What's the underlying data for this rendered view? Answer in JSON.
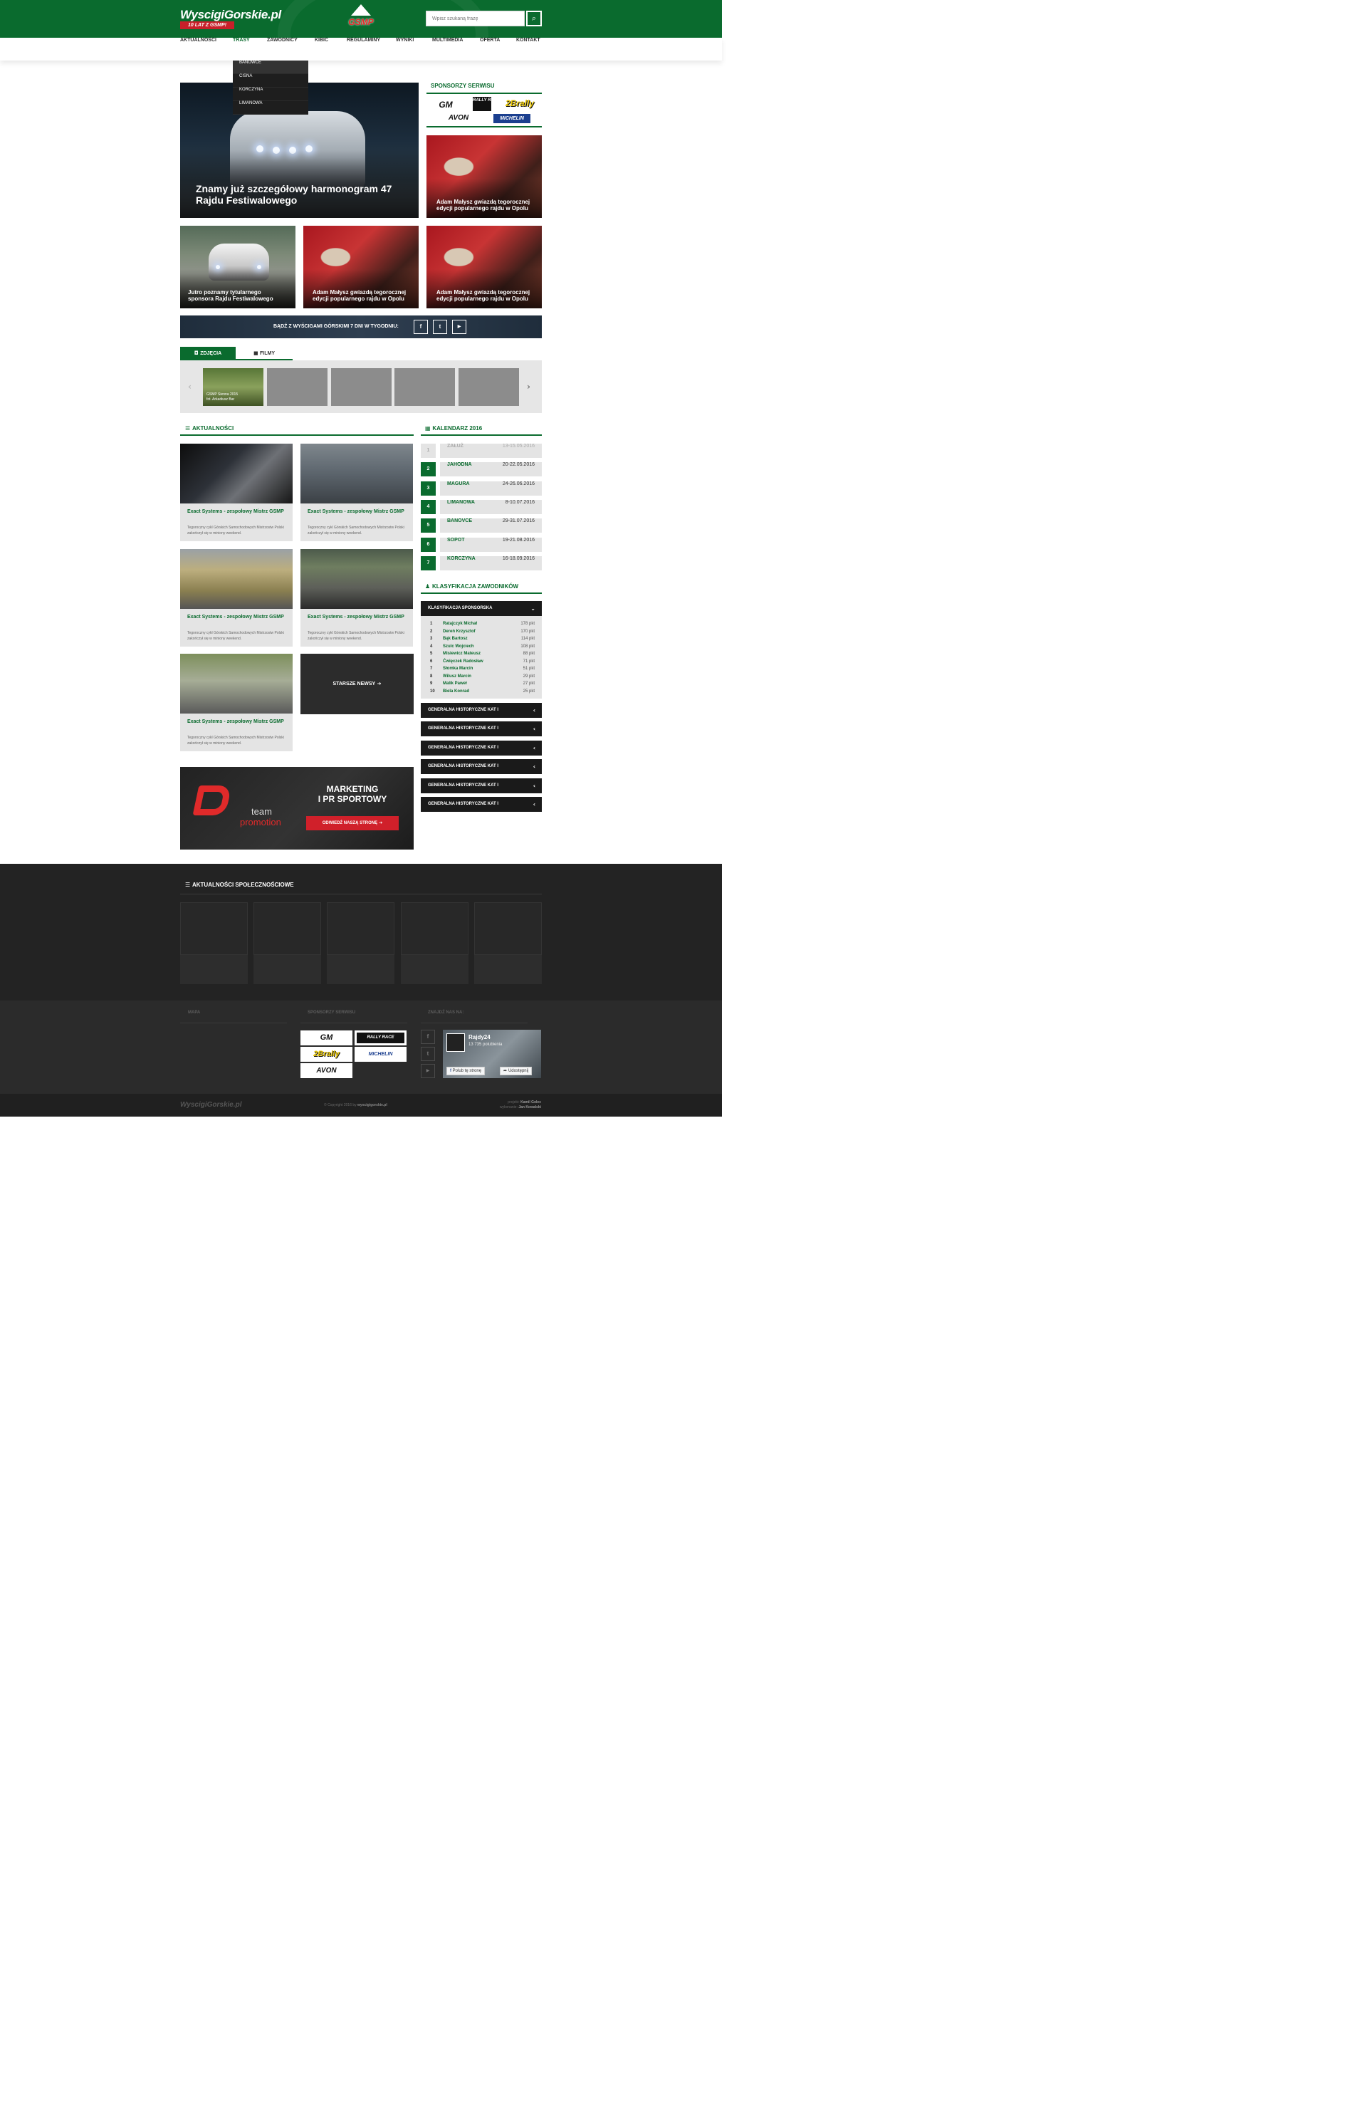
{
  "header": {
    "logo_text": "WyscigiGorskie.pl",
    "logo_badge": "10 LAT Z GSMP!",
    "center_logo": "GSMP",
    "search_placeholder": "Wpisz szukaną frazę",
    "search_icon": "search-icon"
  },
  "nav": {
    "items": [
      "AKTUALNOŚCI",
      "TRASY",
      "ZAWODNICY",
      "KIBIC",
      "REGULAMINY",
      "WYNIKI",
      "MULTIMEDIA",
      "OFERTA",
      "KONTAKT"
    ],
    "active": "TRASY",
    "dropdown": [
      "BANOWCE",
      "CISNA",
      "KORCZYNA",
      "LIMANOWA"
    ]
  },
  "hero": {
    "title": "Znamy już szczegółowy harmonogram 47 Rajdu Festiwalowego"
  },
  "sponsors": {
    "title": "SPONSORZY SERWISU",
    "logos": [
      "GM",
      "RALLY RACE",
      "2Brally",
      "AVON",
      "MICHELIN"
    ]
  },
  "featured": [
    {
      "title": "Adam Małysz gwiazdą tegorocznej edycji popularnego rajdu w Opolu"
    },
    {
      "title": "Jutro poznamy tytularnego sponsora Rajdu Festiwalowego"
    },
    {
      "title": "Adam Małysz gwiazdą tegorocznej edycji popularnego rajdu w Opolu"
    },
    {
      "title": "Adam Małysz gwiazdą tegorocznej edycji popularnego rajdu w Opolu"
    }
  ],
  "social_banner": {
    "text": "BĄDŹ Z WYŚCIGAMI GÓRSKIMI 7 DNI W TYGODNIU:",
    "icons": [
      "f",
      "t",
      "▶"
    ]
  },
  "gallery": {
    "tabs": [
      "ZDJĘCIA",
      "FILMY"
    ],
    "first_caption_line1": "GSMP Sienna 2015",
    "first_caption_line2": "fot. Arkadiusz Bar"
  },
  "news": {
    "title": "AKTUALNOŚCI",
    "item_title": "Exact Systems - zespołowy Mistrz GSMP",
    "item_desc": "Tegoroczny cykl Górskich Samochodowych Mistrzostw Polski zakończył się w miniony weekend.",
    "older_label": "STARSZE NEWSY"
  },
  "calendar": {
    "title": "KALENDARZ 2016",
    "rows": [
      {
        "n": "1",
        "name": "ZAŁUŻ",
        "date": "13-15.05.2016",
        "past": true
      },
      {
        "n": "2",
        "name": "JAHODNA",
        "date": "20-22.05.2016",
        "past": false
      },
      {
        "n": "3",
        "name": "MAGURA",
        "date": "24-26.06.2016",
        "past": false
      },
      {
        "n": "4",
        "name": "LIMANOWA",
        "date": "8-10.07.2016",
        "past": false
      },
      {
        "n": "5",
        "name": "BANOVCE",
        "date": "29-31.07.2016",
        "past": false
      },
      {
        "n": "6",
        "name": "SOPOT",
        "date": "19-21.08.2016",
        "past": false
      },
      {
        "n": "7",
        "name": "KORCZYNA",
        "date": "16-18.09.2016",
        "past": false
      }
    ]
  },
  "classification": {
    "title": "KLASYFIKACJA ZAWODNIKÓW",
    "open_header": "KLASYFIKACJA SPONSORSKA",
    "rows": [
      {
        "n": "1",
        "name": "Ratajczyk Michał",
        "pts": "178 pkt"
      },
      {
        "n": "2",
        "name": "Dereń Krzysztof",
        "pts": "170 pkt"
      },
      {
        "n": "3",
        "name": "Bąk Bartosz",
        "pts": "114 pkt"
      },
      {
        "n": "4",
        "name": "Szulc Wojciech",
        "pts": "108 pkt"
      },
      {
        "n": "5",
        "name": "Misiewicz Mateusz",
        "pts": "88 pkt"
      },
      {
        "n": "6",
        "name": "Ćwięczek Radosław",
        "pts": "71 pkt"
      },
      {
        "n": "7",
        "name": "Słomka Marcin",
        "pts": "51 pkt"
      },
      {
        "n": "8",
        "name": "Wilusz Marcin",
        "pts": "29 pkt"
      },
      {
        "n": "9",
        "name": "Malik Paweł",
        "pts": "27 pkt"
      },
      {
        "n": "10",
        "name": "Biela Konrad",
        "pts": "25 pkt"
      }
    ],
    "collapsed_header": "GENERALNA HISTORYCZNE KAT I"
  },
  "promo": {
    "brand_line1": "team",
    "brand_line2": "promotion",
    "title_line1": "MARKETING",
    "title_line2": "I PR SPORTOWY",
    "button": "ODWIEDŹ NASZĄ STRONĘ"
  },
  "social_news": {
    "title": "AKTUALNOŚCI SPOŁECZNOŚCIOWE"
  },
  "footer": {
    "col1": "MAPA",
    "col2": "SPONSORZY SERWISU",
    "col3": "ZNAJDŹ NAS NA:",
    "sponsor_logos": [
      "GM",
      "RALLY RACE",
      "2Brally",
      "MICHELIN",
      "AVON"
    ],
    "fb_name": "Rajdy24",
    "fb_followers": "13 735 polubienia",
    "fb_like": "Polub tę stronę",
    "fb_share": "Udostępnij",
    "bottom_logo": "WyscigiGorskie.pl",
    "copyright_prefix": "© Copyright 2016 by",
    "copyright_site": "wyscigigorskie.pl",
    "credit1_label": "projekt:",
    "credit1_name": "Kamil Golec",
    "credit2_label": "wykonanie:",
    "credit2_name": "Jan Kowalski"
  },
  "colors": {
    "brand_green": "#0a6b2e",
    "accent_red": "#d0202a",
    "dark": "#232323"
  }
}
